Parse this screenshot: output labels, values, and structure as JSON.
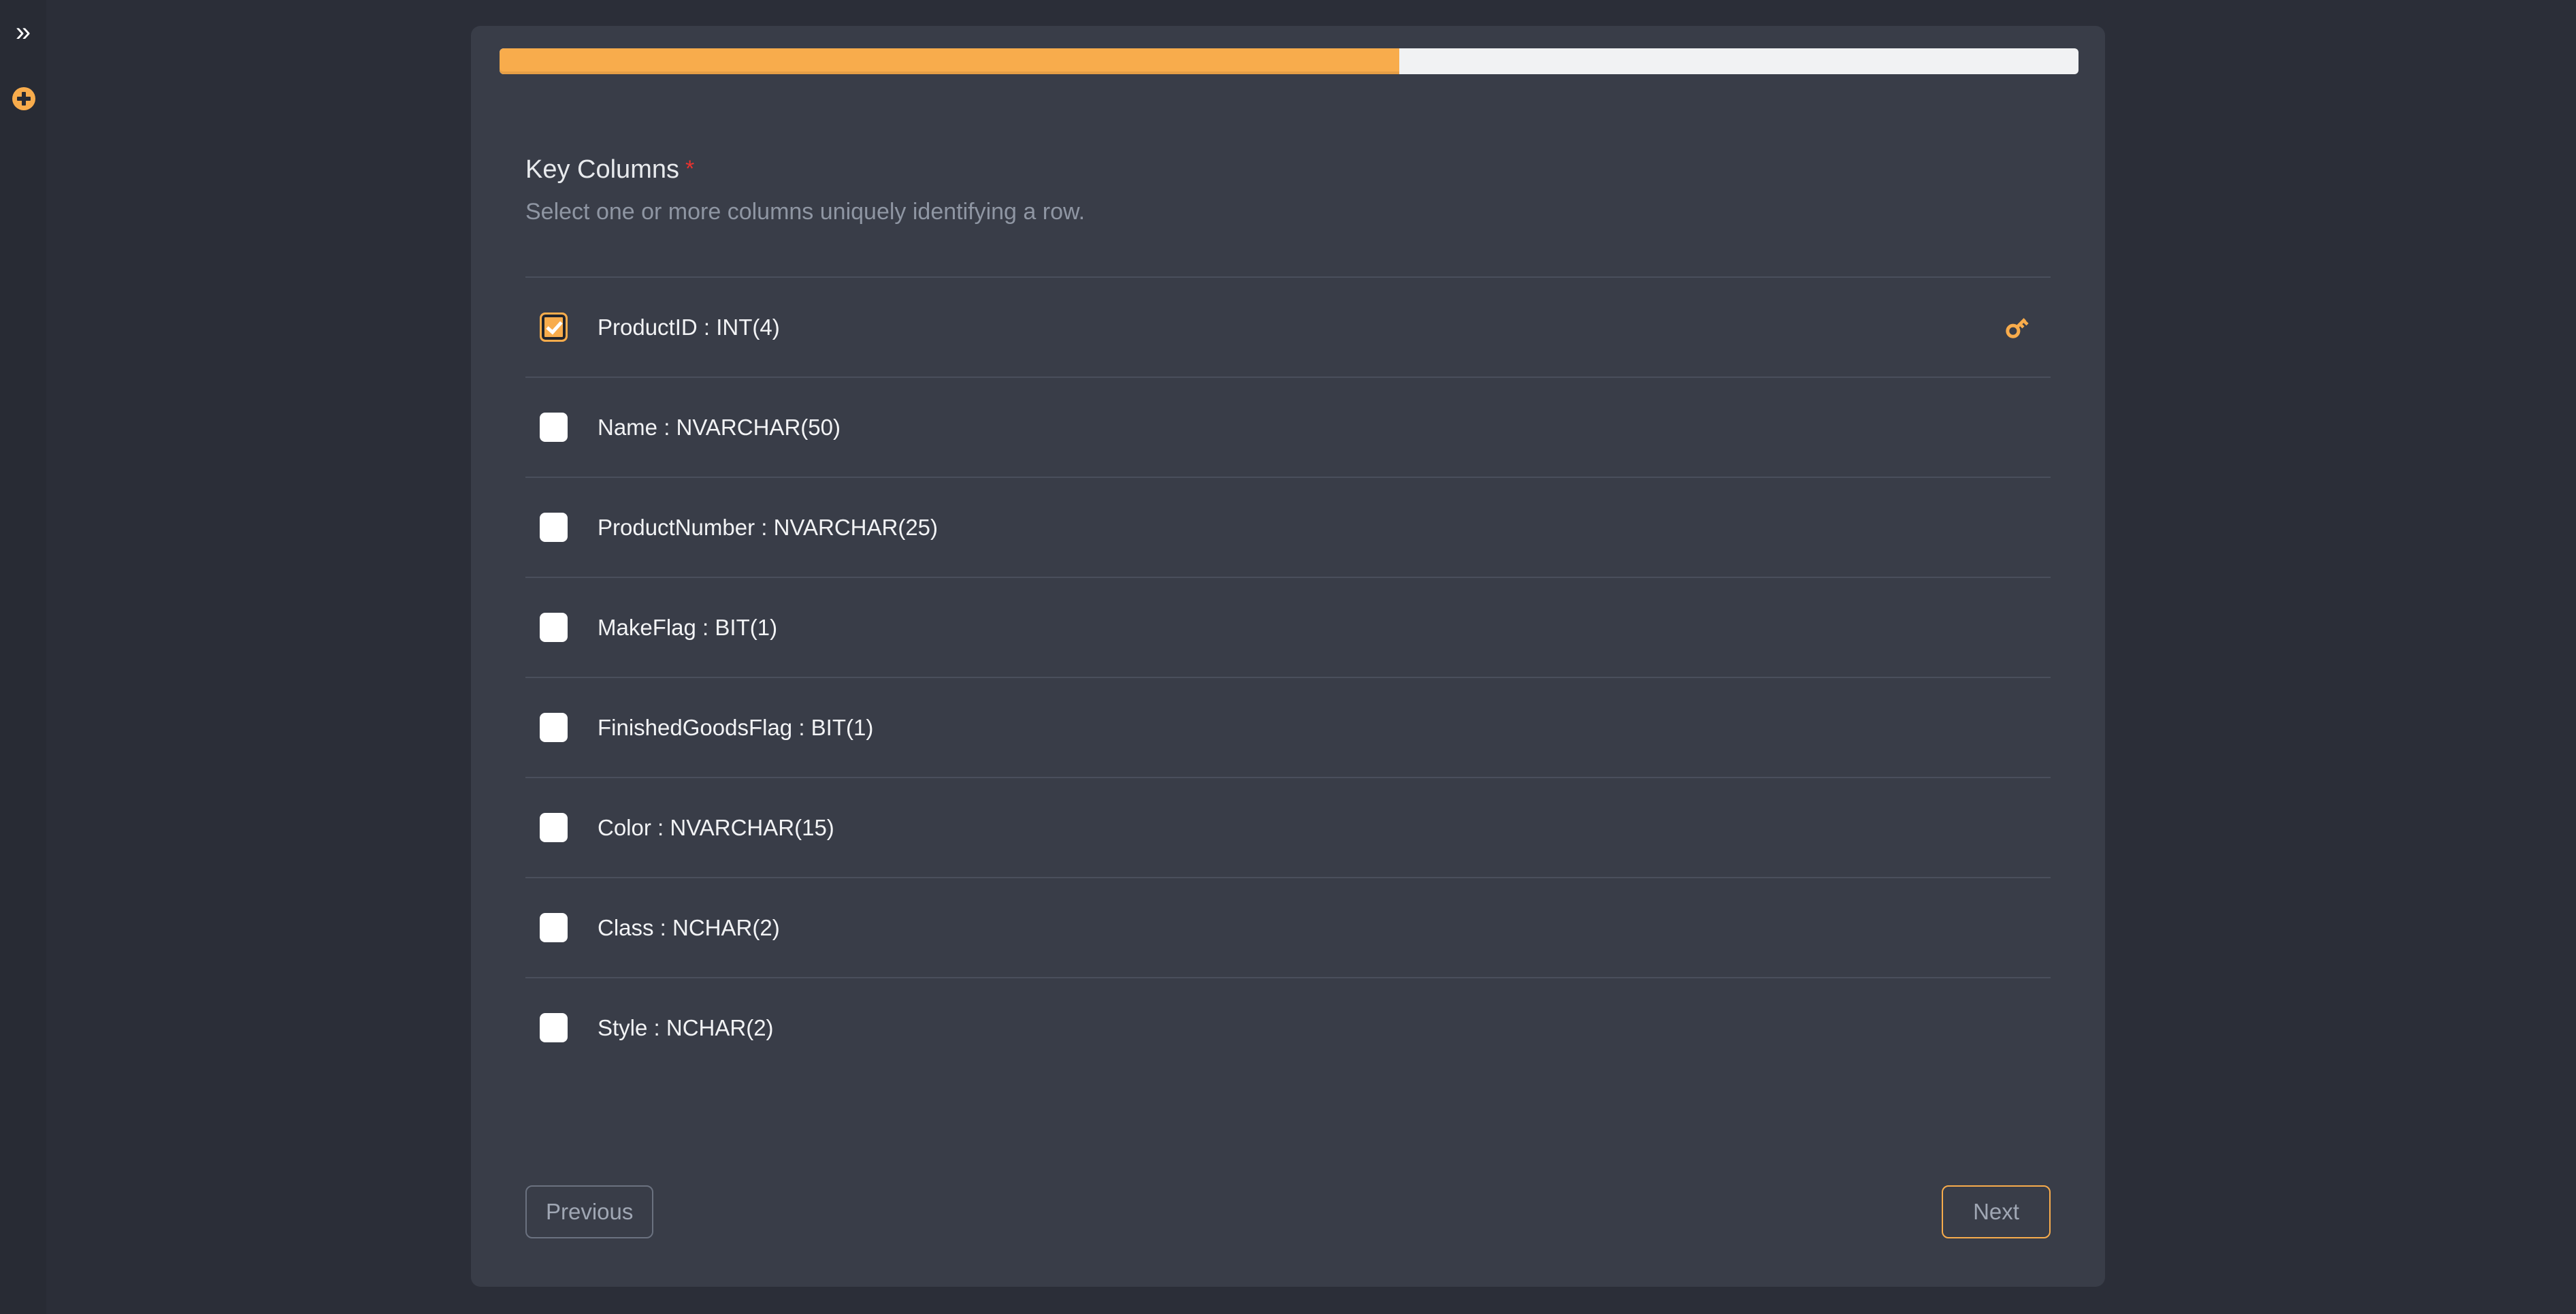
{
  "sidebar": {
    "expand_icon": "double-chevron-right-icon",
    "add_icon": "plus-circle-icon"
  },
  "progress": {
    "percent": 57,
    "fill_color": "#f8ac4c",
    "track_color": "#f1f2f3"
  },
  "header": {
    "title": "Key Columns",
    "required_marker": "*",
    "subtitle": "Select one or more columns uniquely identifying a row."
  },
  "columns": [
    {
      "label": "ProductID : INT(4)",
      "checked": true,
      "key_icon": "key-icon"
    },
    {
      "label": "Name : NVARCHAR(50)",
      "checked": false,
      "key_icon": null
    },
    {
      "label": "ProductNumber : NVARCHAR(25)",
      "checked": false,
      "key_icon": null
    },
    {
      "label": "MakeFlag : BIT(1)",
      "checked": false,
      "key_icon": null
    },
    {
      "label": "FinishedGoodsFlag : BIT(1)",
      "checked": false,
      "key_icon": null
    },
    {
      "label": "Color : NVARCHAR(15)",
      "checked": false,
      "key_icon": null
    },
    {
      "label": "Class : NCHAR(2)",
      "checked": false,
      "key_icon": null
    },
    {
      "label": "Style : NCHAR(2)",
      "checked": false,
      "key_icon": null
    }
  ],
  "footer": {
    "previous_label": "Previous",
    "next_label": "Next"
  },
  "colors": {
    "page_background": "#2b2e38",
    "sidebar_background": "#282b34",
    "card_background": "#393d48",
    "accent": "#f8ac4c",
    "required_red": "#e8332f",
    "muted_text": "#8f96a3",
    "primary_text": "#f2f3f5",
    "divider": "#4a4f5c"
  }
}
